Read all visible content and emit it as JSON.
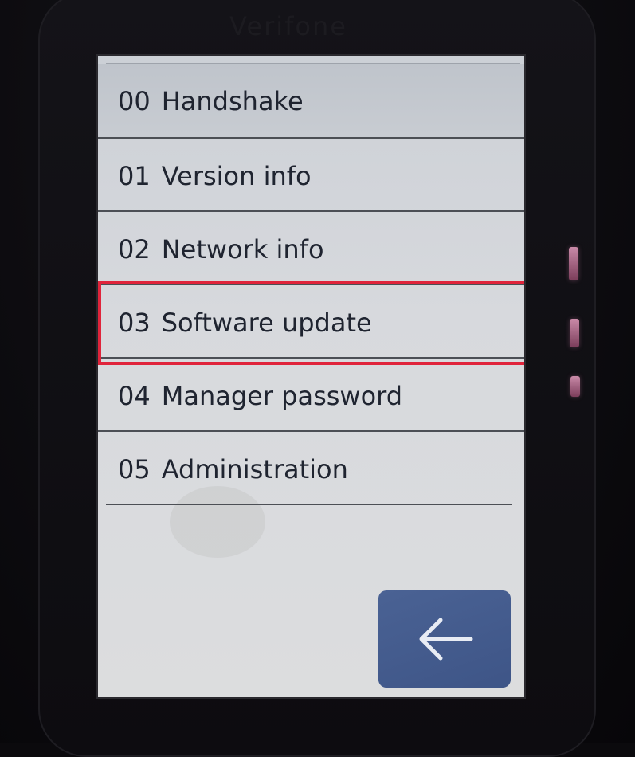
{
  "device": {
    "brand": "Verifone"
  },
  "menu": {
    "items": [
      {
        "code": "00",
        "label": "Handshake"
      },
      {
        "code": "01",
        "label": "Version info"
      },
      {
        "code": "02",
        "label": "Network info"
      },
      {
        "code": "03",
        "label": "Software update"
      },
      {
        "code": "04",
        "label": "Manager password"
      },
      {
        "code": "05",
        "label": "Administration"
      }
    ],
    "highlighted_code": "03"
  },
  "back_button": {
    "icon": "arrow-left-icon"
  },
  "colors": {
    "highlight": "#e0243b",
    "back_button": "#465d90",
    "text": "#1f2430"
  }
}
